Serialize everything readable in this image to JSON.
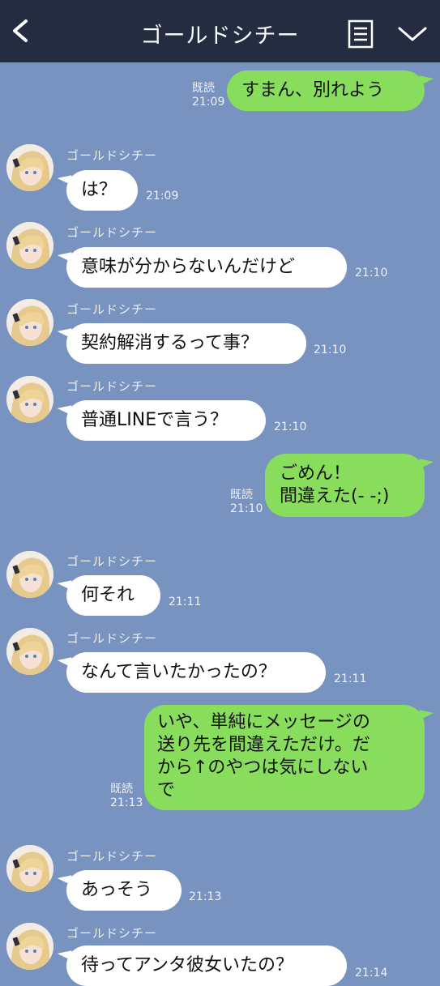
{
  "header": {
    "title": "ゴールドシチー",
    "back_icon": "back-chevron-icon",
    "menu_icon": "notes-icon",
    "dropdown_icon": "chevron-down-icon"
  },
  "colors": {
    "background": "#7893bf",
    "header": "#232c41",
    "outgoing_bubble": "#88dd5c",
    "incoming_bubble": "#ffffff"
  },
  "messages": [
    {
      "dir": "out",
      "text": "すまん、別れよう",
      "read": "既読",
      "time": "21:09"
    },
    {
      "dir": "in",
      "sender": "ゴールドシチー",
      "text": "は？",
      "time": "21:09"
    },
    {
      "dir": "in",
      "sender": "ゴールドシチー",
      "text": "意味が分からないんだけど",
      "time": "21:10"
    },
    {
      "dir": "in",
      "sender": "ゴールドシチー",
      "text": "契約解消するって事？",
      "time": "21:10"
    },
    {
      "dir": "in",
      "sender": "ゴールドシチー",
      "text": "普通LINEで言う？",
      "time": "21:10"
    },
    {
      "dir": "out",
      "lines": [
        "ごめん！",
        "間違えた(- -;)"
      ],
      "read": "既読",
      "time": "21:10"
    },
    {
      "dir": "in",
      "sender": "ゴールドシチー",
      "text": "何それ",
      "time": "21:11"
    },
    {
      "dir": "in",
      "sender": "ゴールドシチー",
      "text": "なんて言いたかったの？",
      "time": "21:11"
    },
    {
      "dir": "out",
      "lines": [
        "いや、単純にメッセージの",
        "送り先を間違えただけ。だ",
        "から↑のやつは気にしない",
        "で"
      ],
      "read": "既読",
      "time": "21:13"
    },
    {
      "dir": "in",
      "sender": "ゴールドシチー",
      "text": "あっそう",
      "time": "21:13"
    },
    {
      "dir": "in",
      "sender": "ゴールドシチー",
      "text": "待ってアンタ彼女いたの？",
      "time": "21:14"
    }
  ]
}
